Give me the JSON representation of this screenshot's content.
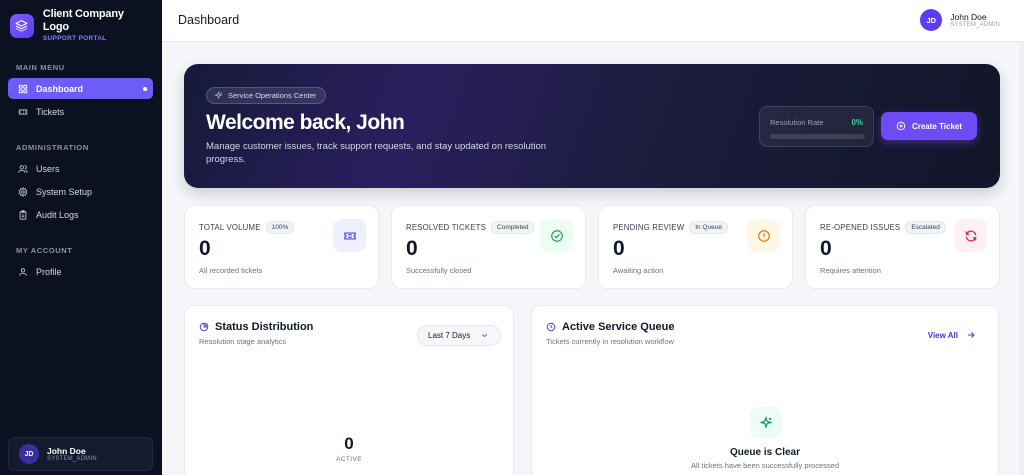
{
  "brand": {
    "name": "Client Company Logo",
    "subtitle": "SUPPORT PORTAL"
  },
  "sidebar": {
    "sections": [
      {
        "label": "MAIN MENU"
      },
      {
        "label": "ADMINISTRATION"
      },
      {
        "label": "MY ACCOUNT"
      }
    ],
    "items": [
      {
        "label": "Dashboard",
        "icon": "grid-icon"
      },
      {
        "label": "Tickets",
        "icon": "ticket-icon"
      },
      {
        "label": "Users",
        "icon": "users-icon"
      },
      {
        "label": "System Setup",
        "icon": "gear-icon"
      },
      {
        "label": "Audit Logs",
        "icon": "clipboard-icon"
      },
      {
        "label": "Profile",
        "icon": "user-icon"
      }
    ],
    "user": {
      "initials": "JD",
      "name": "John Doe",
      "role": "SYSTEM_ADMIN"
    }
  },
  "topbar": {
    "title": "Dashboard",
    "user": {
      "initials": "JD",
      "name": "John Doe",
      "role": "SYSTEM_ADMIN"
    }
  },
  "hero": {
    "badge": "Service Operations Center",
    "title": "Welcome back, John",
    "description": "Manage customer issues, track support requests, and stay updated on resolution progress.",
    "resolution_label": "Resolution Rate",
    "resolution_value": "0%",
    "resolution_fraction": 0,
    "create_button": "Create Ticket",
    "accent": "#6d4cf6",
    "success_color": "#34d399"
  },
  "stats": [
    {
      "label": "TOTAL VOLUME",
      "chip": "100%",
      "value": "0",
      "caption": "All recorded tickets",
      "icon": "ticket-icon",
      "color": "#4f46e5"
    },
    {
      "label": "RESOLVED TICKETS",
      "chip": "Completed",
      "value": "0",
      "caption": "Successfully closed",
      "icon": "check-circle-icon",
      "color": "#16a34a"
    },
    {
      "label": "PENDING REVIEW",
      "chip": "In Queue",
      "value": "0",
      "caption": "Awaiting action",
      "icon": "alert-circle-icon",
      "color": "#d97706"
    },
    {
      "label": "RE-OPENED ISSUES",
      "chip": "Escalated",
      "value": "0",
      "caption": "Requires attention",
      "icon": "refresh-icon",
      "color": "#e11d48"
    }
  ],
  "status_panel": {
    "title": "Status Distribution",
    "subtitle": "Resolution stage analytics",
    "range_selected": "Last 7 Days",
    "center_value": "0",
    "center_label": "ACTIVE"
  },
  "queue_panel": {
    "title": "Active Service Queue",
    "subtitle": "Tickets currently in resolution workflow",
    "view_all": "View All",
    "empty_title": "Queue is Clear",
    "empty_subtitle": "All tickets have been successfully processed"
  }
}
